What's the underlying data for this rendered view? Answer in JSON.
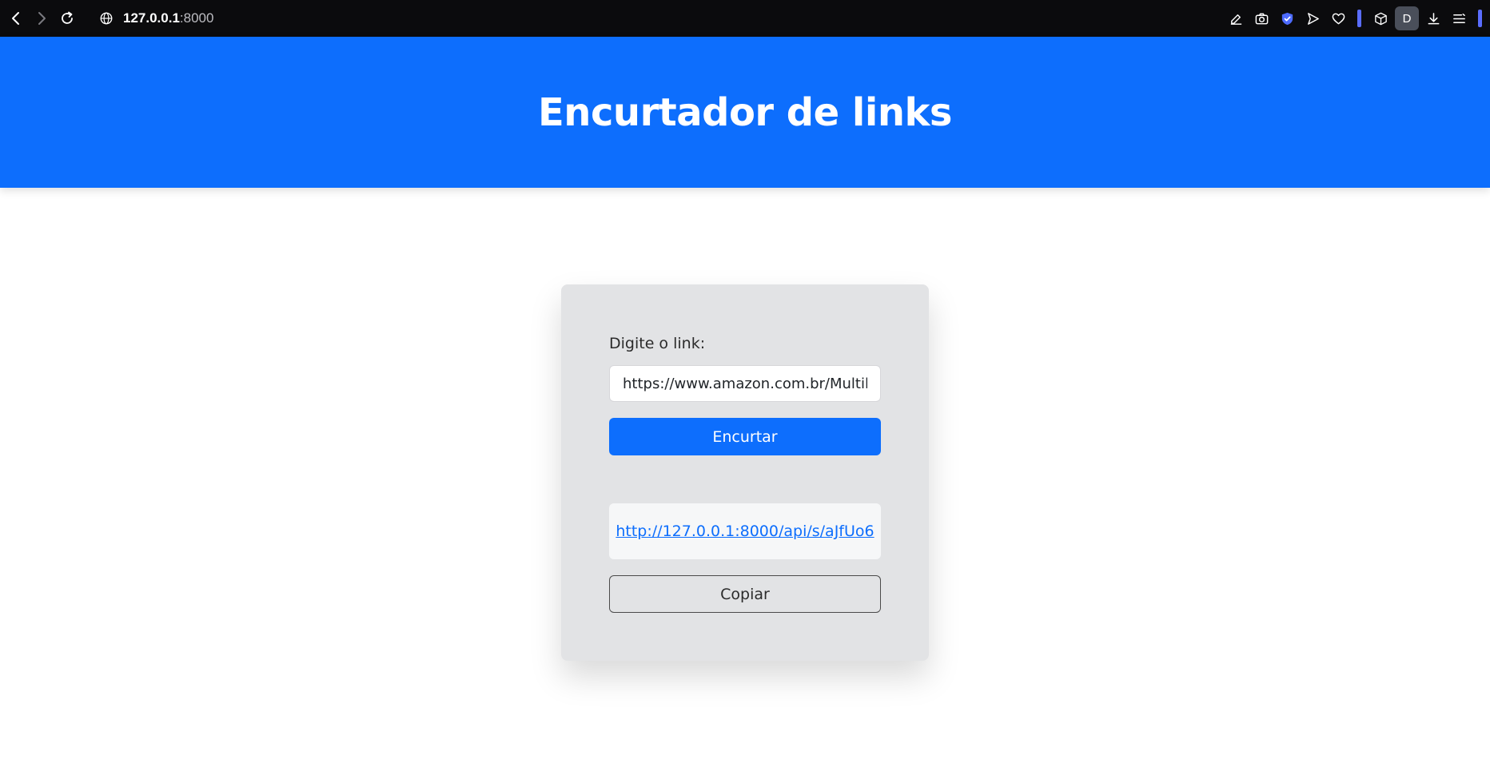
{
  "browser": {
    "url_host": "127.0.0.1",
    "url_port": ":8000",
    "profile_initial": "D",
    "icons": [
      "back-icon",
      "forward-icon",
      "reload-icon",
      "globe-icon",
      "edit-icon",
      "camera-icon",
      "shield-icon",
      "send-icon",
      "heart-icon",
      "cube-icon",
      "download-icon",
      "menu-icon"
    ]
  },
  "header": {
    "title": "Encurtador de links"
  },
  "form": {
    "label": "Digite o link:",
    "input_value": "https://www.amazon.com.br/Multil",
    "submit_label": "Encurtar"
  },
  "result": {
    "short_link": "http://127.0.0.1:8000/api/s/aJfUo6",
    "copy_label": "Copiar"
  },
  "colors": {
    "primary": "#0d6efd",
    "card_bg": "#e2e3e5",
    "toolbar_bg": "#0b0b0d"
  }
}
